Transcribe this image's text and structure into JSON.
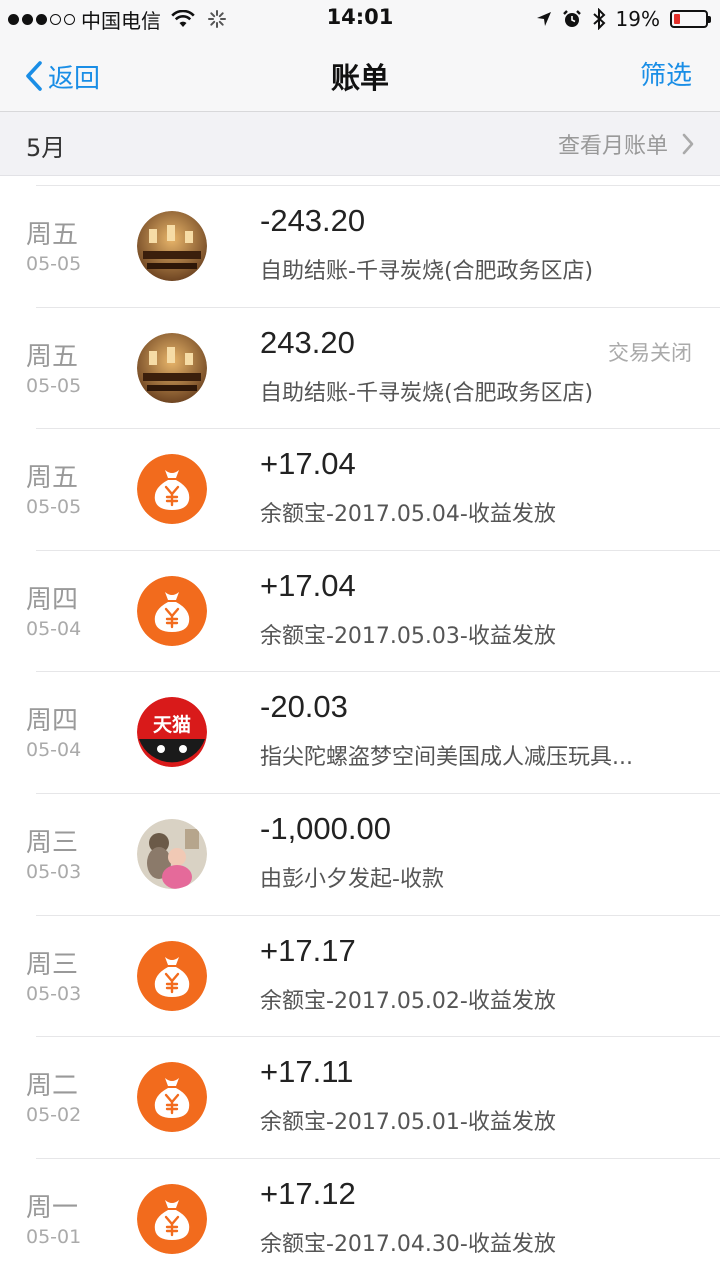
{
  "status_bar": {
    "carrier": "中国电信",
    "time": "14:01",
    "battery": "19%",
    "battery_level": 0.19,
    "icons": [
      "signal-dots-icon",
      "wifi-icon",
      "loading-spinner-icon",
      "location-arrow-icon",
      "alarm-icon",
      "bluetooth-icon",
      "battery-icon"
    ]
  },
  "nav": {
    "back_label": "返回",
    "title": "账单",
    "filter_label": "筛选"
  },
  "month": {
    "label": "5月",
    "link_label": "查看月账单"
  },
  "colors": {
    "accent": "#1a8ee6",
    "yuebao_orange": "#f26b1d",
    "tmall_red": "#d91a1a"
  },
  "bills": [
    {
      "weekday": "周五",
      "date": "05-05",
      "amount": "-243.20",
      "desc": "自助结账-千寻炭烧(合肥政务区店)",
      "status": "",
      "avatar": "restaurant-photo"
    },
    {
      "weekday": "周五",
      "date": "05-05",
      "amount": "243.20",
      "desc": "自助结账-千寻炭烧(合肥政务区店)",
      "status": "交易关闭",
      "avatar": "restaurant-photo"
    },
    {
      "weekday": "周五",
      "date": "05-05",
      "amount": "+17.04",
      "desc": "余额宝-2017.05.04-收益发放",
      "status": "",
      "avatar": "yuebao-moneybag-icon"
    },
    {
      "weekday": "周四",
      "date": "05-04",
      "amount": "+17.04",
      "desc": "余额宝-2017.05.03-收益发放",
      "status": "",
      "avatar": "yuebao-moneybag-icon"
    },
    {
      "weekday": "周四",
      "date": "05-04",
      "amount": "-20.03",
      "desc": "指尖陀螺盗梦空间美国成人减压玩具...",
      "status": "",
      "avatar": "tmall-logo",
      "avatar_text": "天猫"
    },
    {
      "weekday": "周三",
      "date": "05-03",
      "amount": "-1,000.00",
      "desc": "由彭小夕发起-收款",
      "status": "",
      "avatar": "person-photo"
    },
    {
      "weekday": "周三",
      "date": "05-03",
      "amount": "+17.17",
      "desc": "余额宝-2017.05.02-收益发放",
      "status": "",
      "avatar": "yuebao-moneybag-icon"
    },
    {
      "weekday": "周二",
      "date": "05-02",
      "amount": "+17.11",
      "desc": "余额宝-2017.05.01-收益发放",
      "status": "",
      "avatar": "yuebao-moneybag-icon"
    },
    {
      "weekday": "周一",
      "date": "05-01",
      "amount": "+17.12",
      "desc": "余额宝-2017.04.30-收益发放",
      "status": "",
      "avatar": "yuebao-moneybag-icon"
    }
  ]
}
